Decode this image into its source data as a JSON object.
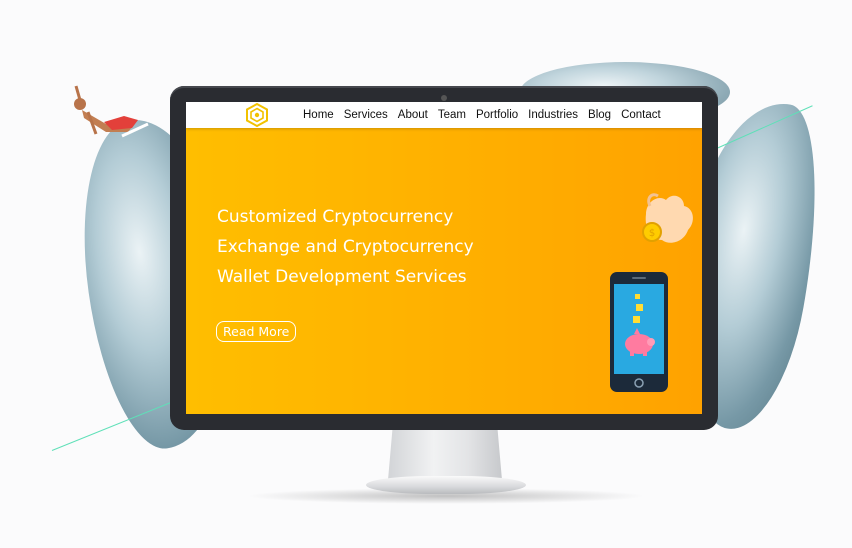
{
  "nav": {
    "items": [
      "Home",
      "Services",
      "About",
      "Team",
      "Portfolio",
      "Industries",
      "Blog",
      "Contact"
    ]
  },
  "hero": {
    "title_lines": [
      "Customized Cryptocurrency",
      "Exchange and Cryptocurrency",
      "Wallet Development Services"
    ],
    "cta_label": "Read More"
  },
  "colors": {
    "hero_bg": "#ffae00",
    "logo": "#f2c200",
    "accent_line": "#5fe0b8"
  },
  "icons": {
    "logo": "hexagon-logo-icon",
    "illustration": "phone-piggy-bank-illustration"
  }
}
